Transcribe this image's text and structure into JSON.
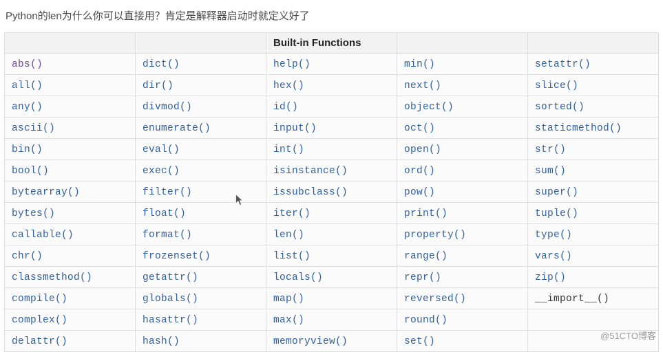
{
  "heading": "Python的len为什么你可以直接用？肯定是解释器启动时就定义好了",
  "table": {
    "header": [
      "",
      "",
      "Built-in Functions",
      "",
      ""
    ],
    "rows": [
      [
        {
          "label": "abs()",
          "style": "visited"
        },
        {
          "label": "dict()",
          "style": "normal"
        },
        {
          "label": "help()",
          "style": "normal"
        },
        {
          "label": "min()",
          "style": "normal"
        },
        {
          "label": "setattr()",
          "style": "normal"
        }
      ],
      [
        {
          "label": "all()",
          "style": "normal"
        },
        {
          "label": "dir()",
          "style": "normal"
        },
        {
          "label": "hex()",
          "style": "normal"
        },
        {
          "label": "next()",
          "style": "normal"
        },
        {
          "label": "slice()",
          "style": "normal"
        }
      ],
      [
        {
          "label": "any()",
          "style": "normal"
        },
        {
          "label": "divmod()",
          "style": "normal"
        },
        {
          "label": "id()",
          "style": "normal"
        },
        {
          "label": "object()",
          "style": "normal"
        },
        {
          "label": "sorted()",
          "style": "normal"
        }
      ],
      [
        {
          "label": "ascii()",
          "style": "normal"
        },
        {
          "label": "enumerate()",
          "style": "normal"
        },
        {
          "label": "input()",
          "style": "normal"
        },
        {
          "label": "oct()",
          "style": "normal"
        },
        {
          "label": "staticmethod()",
          "style": "normal"
        }
      ],
      [
        {
          "label": "bin()",
          "style": "normal"
        },
        {
          "label": "eval()",
          "style": "normal"
        },
        {
          "label": "int()",
          "style": "normal"
        },
        {
          "label": "open()",
          "style": "normal"
        },
        {
          "label": "str()",
          "style": "normal"
        }
      ],
      [
        {
          "label": "bool()",
          "style": "normal"
        },
        {
          "label": "exec()",
          "style": "normal"
        },
        {
          "label": "isinstance()",
          "style": "normal"
        },
        {
          "label": "ord()",
          "style": "normal"
        },
        {
          "label": "sum()",
          "style": "normal"
        }
      ],
      [
        {
          "label": "bytearray()",
          "style": "normal"
        },
        {
          "label": "filter()",
          "style": "normal"
        },
        {
          "label": "issubclass()",
          "style": "normal"
        },
        {
          "label": "pow()",
          "style": "normal"
        },
        {
          "label": "super()",
          "style": "normal"
        }
      ],
      [
        {
          "label": "bytes()",
          "style": "normal"
        },
        {
          "label": "float()",
          "style": "normal"
        },
        {
          "label": "iter()",
          "style": "normal"
        },
        {
          "label": "print()",
          "style": "normal"
        },
        {
          "label": "tuple()",
          "style": "normal"
        }
      ],
      [
        {
          "label": "callable()",
          "style": "normal"
        },
        {
          "label": "format()",
          "style": "normal"
        },
        {
          "label": "len()",
          "style": "normal"
        },
        {
          "label": "property()",
          "style": "normal"
        },
        {
          "label": "type()",
          "style": "normal"
        }
      ],
      [
        {
          "label": "chr()",
          "style": "normal"
        },
        {
          "label": "frozenset()",
          "style": "normal"
        },
        {
          "label": "list()",
          "style": "normal"
        },
        {
          "label": "range()",
          "style": "normal"
        },
        {
          "label": "vars()",
          "style": "normal"
        }
      ],
      [
        {
          "label": "classmethod()",
          "style": "normal"
        },
        {
          "label": "getattr()",
          "style": "normal"
        },
        {
          "label": "locals()",
          "style": "normal"
        },
        {
          "label": "repr()",
          "style": "normal"
        },
        {
          "label": "zip()",
          "style": "normal"
        }
      ],
      [
        {
          "label": "compile()",
          "style": "normal"
        },
        {
          "label": "globals()",
          "style": "normal"
        },
        {
          "label": "map()",
          "style": "normal"
        },
        {
          "label": "reversed()",
          "style": "normal"
        },
        {
          "label": "__import__()",
          "style": "black"
        }
      ],
      [
        {
          "label": "complex()",
          "style": "normal"
        },
        {
          "label": "hasattr()",
          "style": "normal"
        },
        {
          "label": "max()",
          "style": "normal"
        },
        {
          "label": "round()",
          "style": "normal"
        },
        {
          "label": "",
          "style": "empty"
        }
      ],
      [
        {
          "label": "delattr()",
          "style": "normal"
        },
        {
          "label": "hash()",
          "style": "normal"
        },
        {
          "label": "memoryview()",
          "style": "normal"
        },
        {
          "label": "set()",
          "style": "normal"
        },
        {
          "label": "",
          "style": "empty"
        }
      ]
    ]
  },
  "watermark": "@51CTO博客"
}
